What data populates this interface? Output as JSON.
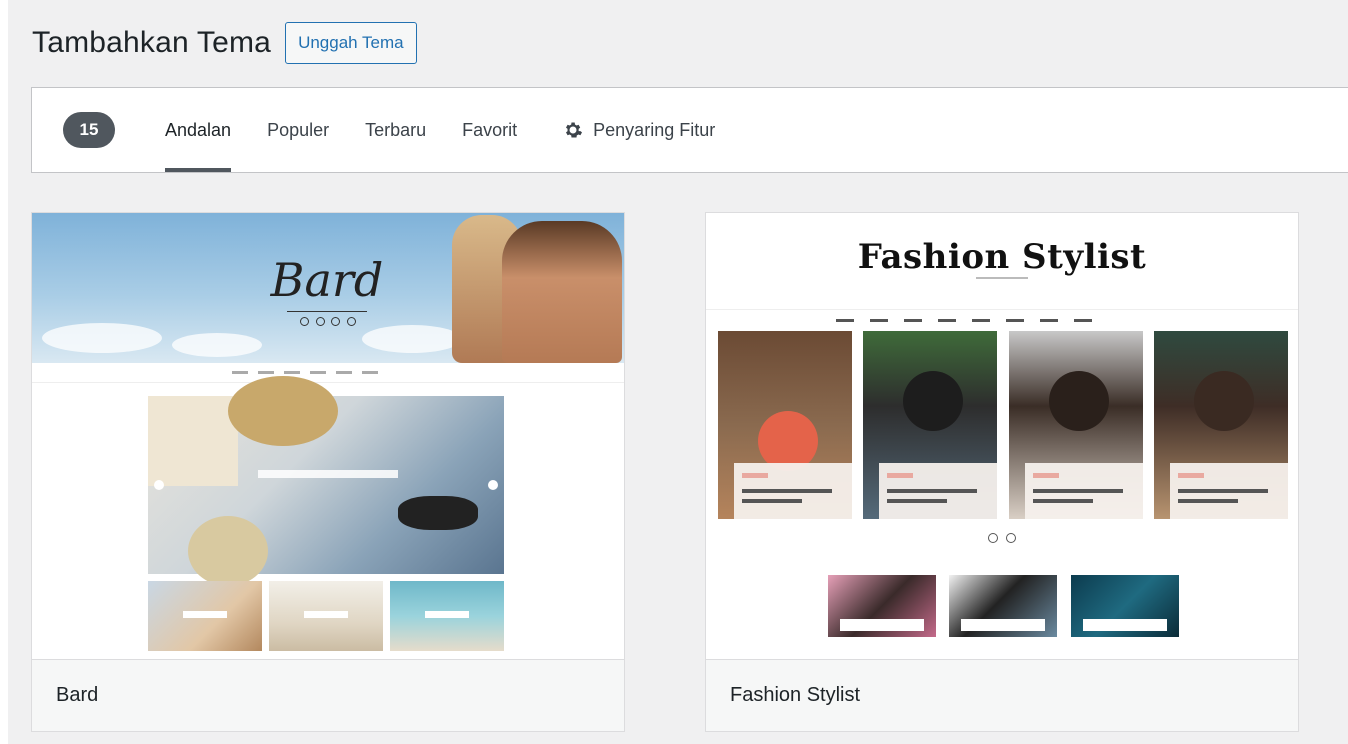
{
  "header": {
    "title": "Tambahkan Tema",
    "upload_label": "Unggah Tema"
  },
  "filter_bar": {
    "count": "15",
    "tabs": [
      {
        "label": "Andalan",
        "active": true
      },
      {
        "label": "Populer",
        "active": false
      },
      {
        "label": "Terbaru",
        "active": false
      },
      {
        "label": "Favorit",
        "active": false
      }
    ],
    "feature_filter_label": "Penyaring Fitur",
    "feature_filter_icon": "gear-icon"
  },
  "themes": [
    {
      "name": "Bard",
      "preview_logo": "Bard"
    },
    {
      "name": "Fashion Stylist",
      "preview_logo": "Fashion Stylist"
    }
  ],
  "colors": {
    "accent": "#2271b1",
    "badge": "#50575e",
    "background": "#f0f0f1"
  }
}
